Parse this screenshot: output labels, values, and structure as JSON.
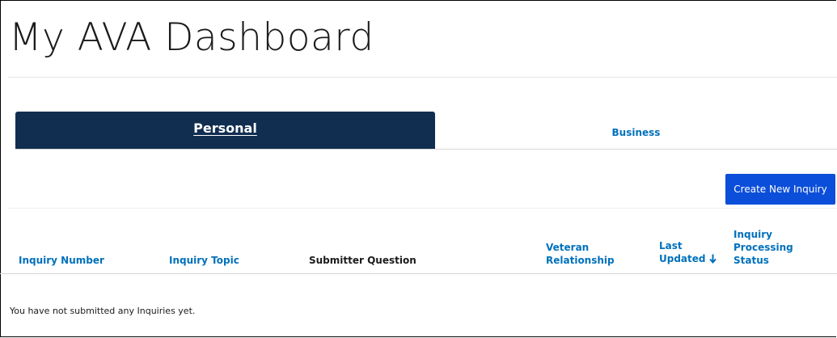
{
  "page": {
    "title": "My AVA Dashboard"
  },
  "tabs": [
    {
      "label": "Personal",
      "active": true
    },
    {
      "label": "Business",
      "active": false
    }
  ],
  "actions": {
    "create_label": "Create New Inquiry"
  },
  "table": {
    "columns": [
      {
        "line1": "Inquiry Number",
        "sortable": true
      },
      {
        "line1": "Inquiry Topic",
        "sortable": true
      },
      {
        "line1": "Submitter Question",
        "sortable": false
      },
      {
        "line1": "Veteran",
        "line2": "Relationship",
        "sortable": true
      },
      {
        "line1": "Last",
        "line2": "Updated",
        "sortable": true,
        "sorted": "descending"
      },
      {
        "line1": "Inquiry",
        "line2": "Processing",
        "line3": "Status",
        "sortable": true
      }
    ],
    "empty_message": "You have not submitted any Inquiries yet."
  },
  "theme": {
    "tab_active_bg": "#112e51",
    "link_color": "#0071bc",
    "button_bg": "#0b4ed9"
  },
  "icons": {
    "sort": "arrow-down-icon"
  }
}
